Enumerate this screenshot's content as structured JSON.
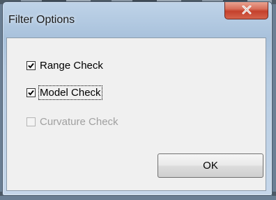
{
  "window": {
    "title": "Filter Options"
  },
  "checkboxes": [
    {
      "label": "Range Check",
      "checked": true,
      "enabled": true
    },
    {
      "label": "Model Check",
      "checked": true,
      "enabled": true,
      "focused": true
    },
    {
      "label": "Curvature Check",
      "checked": false,
      "enabled": false
    }
  ],
  "buttons": {
    "ok_label": "OK"
  },
  "icons": {
    "close": "close-icon",
    "check": "checkmark-icon"
  },
  "colors": {
    "close_button": "#c4412c",
    "frame": "#a9c2dc",
    "client_bg": "#f0f0f0",
    "disabled_text": "#a0a0a0"
  }
}
